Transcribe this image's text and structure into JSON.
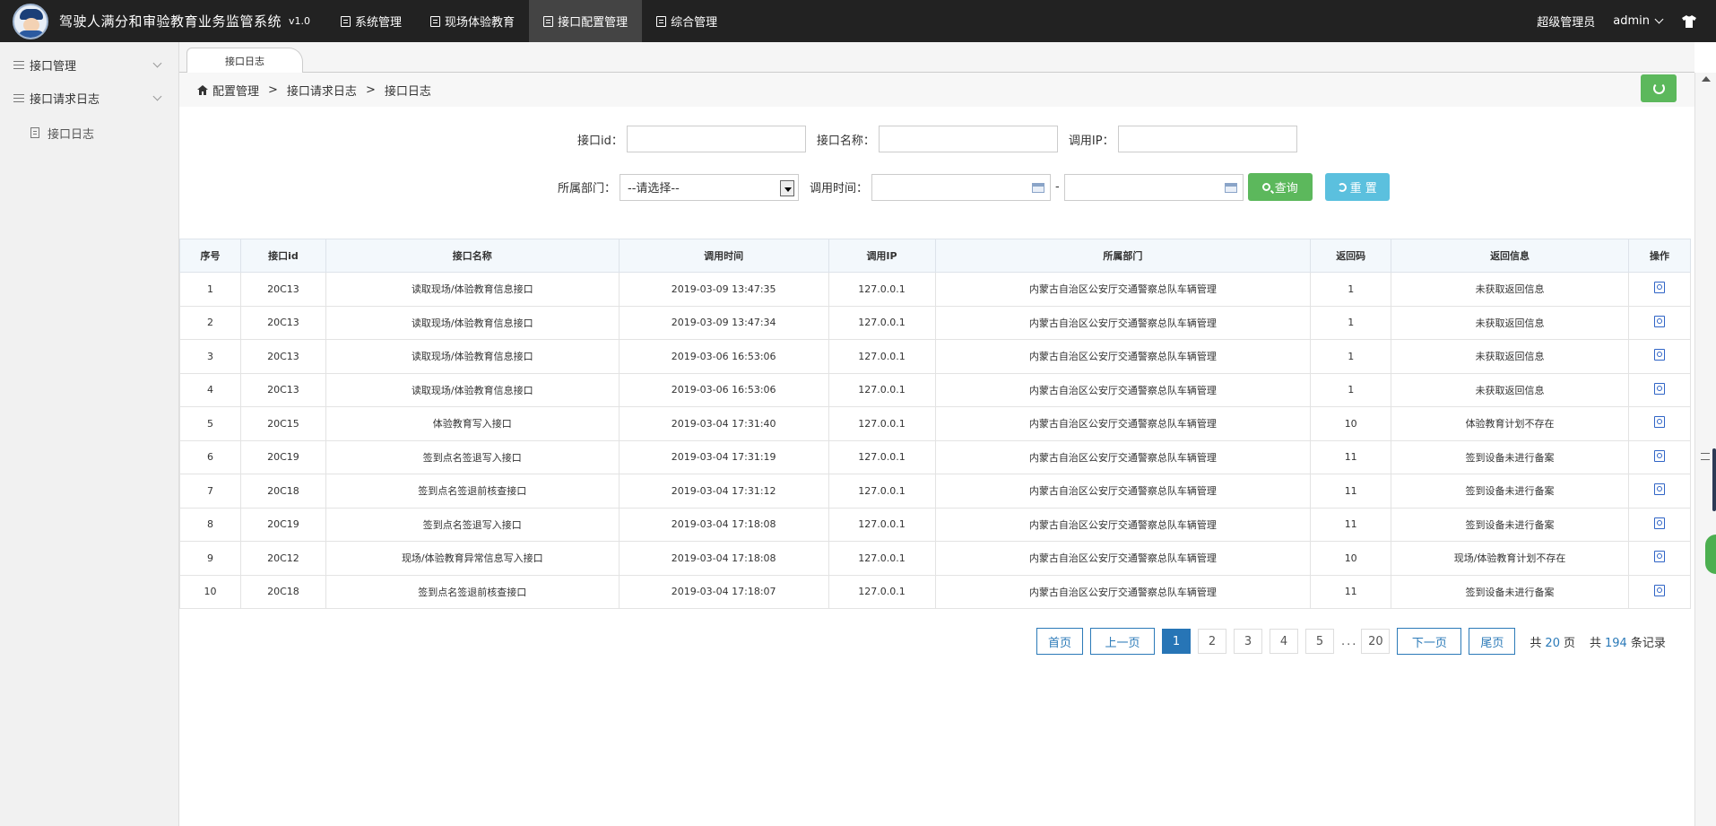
{
  "app": {
    "title": "驾驶人满分和审验教育业务监管系统",
    "version": "v1.0"
  },
  "topnav": [
    {
      "label": "系统管理",
      "active": false
    },
    {
      "label": "现场体验教育",
      "active": false
    },
    {
      "label": "接口配置管理",
      "active": true
    },
    {
      "label": "综合管理",
      "active": false
    }
  ],
  "user": {
    "role": "超级管理员",
    "name": "admin"
  },
  "sidebar": {
    "groups": [
      {
        "label": "接口管理"
      },
      {
        "label": "接口请求日志"
      }
    ],
    "sub_items": [
      {
        "label": "接口日志"
      }
    ]
  },
  "tabs": [
    {
      "label": "接口日志"
    }
  ],
  "breadcrumb": {
    "items": [
      "配置管理",
      "接口请求日志",
      "接口日志"
    ],
    "separator": ">"
  },
  "filters": {
    "interface_id_label": "接口id：",
    "interface_name_label": "接口名称：",
    "ip_label": "调用IP：",
    "dept_label": "所属部门：",
    "dept_selected": "--请选择--",
    "time_label": "调用时间：",
    "time_sep": "-",
    "search_label": "查询",
    "reset_label": "重 置"
  },
  "table": {
    "headers": [
      "序号",
      "接口id",
      "接口名称",
      "调用时间",
      "调用IP",
      "所属部门",
      "返回码",
      "返回信息",
      "操作"
    ],
    "rows": [
      [
        "1",
        "20C13",
        "读取现场/体验教育信息接口",
        "2019-03-09 13:47:35",
        "127.0.0.1",
        "内蒙古自治区公安厅交通警察总队车辆管理",
        "1",
        "未获取返回信息"
      ],
      [
        "2",
        "20C13",
        "读取现场/体验教育信息接口",
        "2019-03-09 13:47:34",
        "127.0.0.1",
        "内蒙古自治区公安厅交通警察总队车辆管理",
        "1",
        "未获取返回信息"
      ],
      [
        "3",
        "20C13",
        "读取现场/体验教育信息接口",
        "2019-03-06 16:53:06",
        "127.0.0.1",
        "内蒙古自治区公安厅交通警察总队车辆管理",
        "1",
        "未获取返回信息"
      ],
      [
        "4",
        "20C13",
        "读取现场/体验教育信息接口",
        "2019-03-06 16:53:06",
        "127.0.0.1",
        "内蒙古自治区公安厅交通警察总队车辆管理",
        "1",
        "未获取返回信息"
      ],
      [
        "5",
        "20C15",
        "体验教育写入接口",
        "2019-03-04 17:31:40",
        "127.0.0.1",
        "内蒙古自治区公安厅交通警察总队车辆管理",
        "10",
        "体验教育计划不存在"
      ],
      [
        "6",
        "20C19",
        "签到点名签退写入接口",
        "2019-03-04 17:31:19",
        "127.0.0.1",
        "内蒙古自治区公安厅交通警察总队车辆管理",
        "11",
        "签到设备未进行备案"
      ],
      [
        "7",
        "20C18",
        "签到点名签退前核查接口",
        "2019-03-04 17:31:12",
        "127.0.0.1",
        "内蒙古自治区公安厅交通警察总队车辆管理",
        "11",
        "签到设备未进行备案"
      ],
      [
        "8",
        "20C19",
        "签到点名签退写入接口",
        "2019-03-04 17:18:08",
        "127.0.0.1",
        "内蒙古自治区公安厅交通警察总队车辆管理",
        "11",
        "签到设备未进行备案"
      ],
      [
        "9",
        "20C12",
        "现场/体验教育异常信息写入接口",
        "2019-03-04 17:18:08",
        "127.0.0.1",
        "内蒙古自治区公安厅交通警察总队车辆管理",
        "10",
        "现场/体验教育计划不存在"
      ],
      [
        "10",
        "20C18",
        "签到点名签退前核查接口",
        "2019-03-04 17:18:07",
        "127.0.0.1",
        "内蒙古自治区公安厅交通警察总队车辆管理",
        "11",
        "签到设备未进行备案"
      ]
    ]
  },
  "pagination": {
    "first": "首页",
    "prev": "上一页",
    "next": "下一页",
    "last": "尾页",
    "pages": [
      "1",
      "2",
      "3",
      "4",
      "5"
    ],
    "ellipsis": "...",
    "last_page": "20",
    "current": "1",
    "total_pages_prefix": "共",
    "total_pages": "20",
    "total_pages_suffix": "页",
    "total_records_prefix": "共",
    "total_records": "194",
    "total_records_suffix": "条记录"
  },
  "icons": {
    "nav": "document-icon",
    "home": "home-icon",
    "refresh": "refresh-icon",
    "op": "view-detail-icon",
    "theme": "shirt-icon"
  },
  "colors": {
    "topbar": "#222222",
    "accent": "#2775b6",
    "success": "#5cb85c",
    "info": "#5bc0de"
  }
}
